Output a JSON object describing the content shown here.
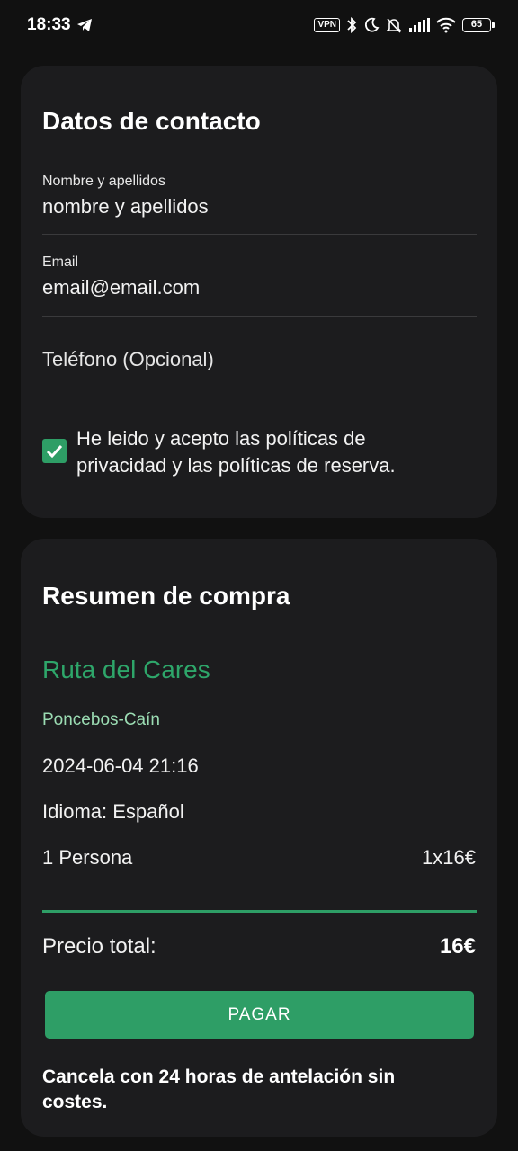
{
  "status_bar": {
    "time": "18:33",
    "vpn": "VPN",
    "battery": "65",
    "icons": [
      "telegram-icon",
      "bluetooth-icon",
      "moon-icon",
      "bell-off-icon",
      "signal-icon",
      "wifi-icon",
      "battery-icon"
    ]
  },
  "contact": {
    "title": "Datos de contacto",
    "name_label": "Nombre y apellidos",
    "name_value": "nombre y apellidos",
    "email_label": "Email",
    "email_value": "email@email.com",
    "phone_placeholder": "Teléfono (Opcional)",
    "consent_checked": true,
    "consent_text": "He leido y acepto las políticas de privacidad y las políticas de reserva."
  },
  "summary": {
    "title": "Resumen de compra",
    "route_name": "Ruta del Cares",
    "route_sub": "Poncebos-Caín",
    "datetime": "2024-06-04 21:16",
    "language": "Idioma: Español",
    "persons": "1 Persona",
    "unit_price": "1x16€",
    "total_label": "Precio total:",
    "total_value": "16€",
    "pay_label": "PAGAR",
    "cancel_note": "Cancela con 24 horas de antelación sin costes."
  },
  "colors": {
    "accent": "#2e9e66",
    "background": "#111111",
    "card": "#1c1c1e"
  }
}
